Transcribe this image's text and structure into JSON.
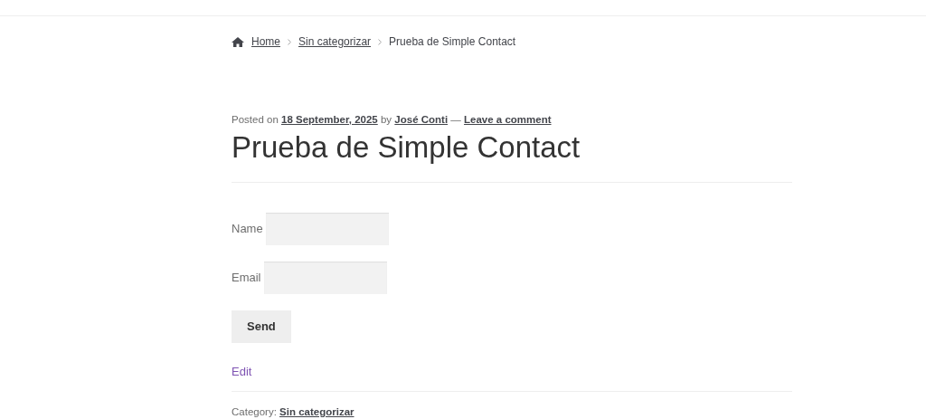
{
  "breadcrumb": [
    {
      "label": "Home",
      "kind": "link"
    },
    {
      "label": "Sin categorizar",
      "kind": "link"
    },
    {
      "label": "Prueba de Simple Contact",
      "kind": "current"
    }
  ],
  "post": {
    "meta": [
      {
        "kind": "text",
        "text": "Posted on"
      },
      {
        "kind": "link",
        "text": "18 September, 2025"
      },
      {
        "kind": "text",
        "text": "by"
      },
      {
        "kind": "link",
        "text": "José Conti"
      },
      {
        "kind": "text",
        "text": "—"
      },
      {
        "kind": "link",
        "text": "Leave a comment"
      }
    ],
    "title": "Prueba de Simple Contact",
    "form": {
      "fields": [
        {
          "label": "Name"
        },
        {
          "label": "Email"
        }
      ],
      "submit": "Send"
    },
    "edit_link": "Edit",
    "footer": [
      {
        "kind": "text",
        "text": "Category:"
      },
      {
        "kind": "link",
        "text": "Sin categorizar"
      }
    ]
  }
}
